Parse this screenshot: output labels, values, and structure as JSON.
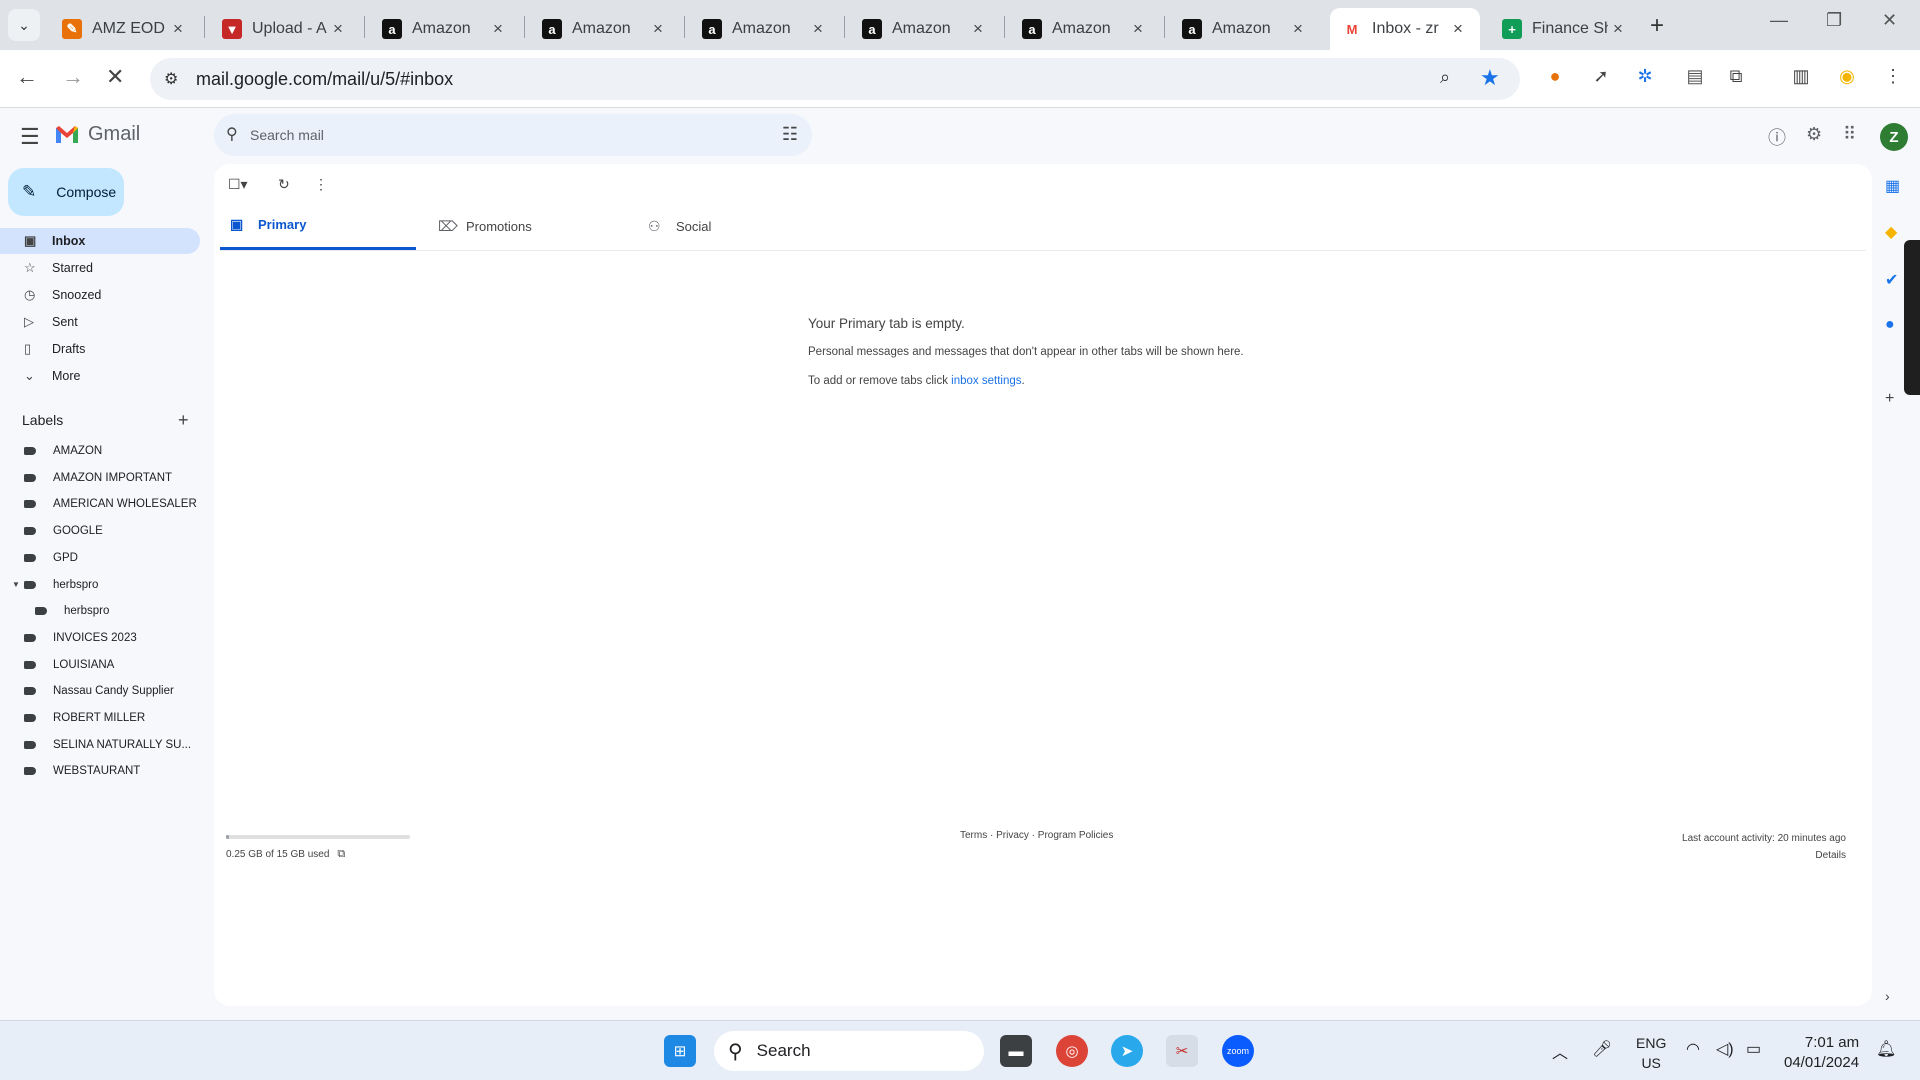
{
  "browser": {
    "tabs": [
      {
        "title": "AMZ EOD",
        "icon": "amz-eod-icon",
        "color": "#e8710a",
        "glyph": "✎"
      },
      {
        "title": "Upload - A",
        "icon": "upload-icon",
        "color": "#c62828",
        "glyph": "▼"
      },
      {
        "title": "Amazon",
        "icon": "amazon-icon",
        "color": "#111111",
        "glyph": "a"
      },
      {
        "title": "Amazon",
        "icon": "amazon-icon",
        "color": "#111111",
        "glyph": "a"
      },
      {
        "title": "Amazon",
        "icon": "amazon-icon",
        "color": "#111111",
        "glyph": "a"
      },
      {
        "title": "Amazon",
        "icon": "amazon-icon",
        "color": "#111111",
        "glyph": "a"
      },
      {
        "title": "Amazon",
        "icon": "amazon-icon",
        "color": "#111111",
        "glyph": "a"
      },
      {
        "title": "Amazon",
        "icon": "amazon-icon",
        "color": "#111111",
        "glyph": "a"
      },
      {
        "title": "Inbox - zr",
        "icon": "gmail-icon",
        "color": "#ffffff",
        "glyph": "M",
        "active": true
      },
      {
        "title": "Finance Sh",
        "icon": "sheets-icon",
        "color": "#0f9d58",
        "glyph": "+"
      }
    ],
    "url": "mail.google.com/mail/u/5/#inbox"
  },
  "gmail": {
    "app_name": "Gmail",
    "search_placeholder": "Search mail",
    "compose_label": "Compose",
    "avatar_initial": "Z",
    "nav": [
      {
        "label": "Inbox",
        "icon": "inbox-icon",
        "glyph": "▣",
        "active": true
      },
      {
        "label": "Starred",
        "icon": "star-icon",
        "glyph": "☆"
      },
      {
        "label": "Snoozed",
        "icon": "clock-icon",
        "glyph": "◷"
      },
      {
        "label": "Sent",
        "icon": "send-icon",
        "glyph": "▷"
      },
      {
        "label": "Drafts",
        "icon": "draft-icon",
        "glyph": "▯"
      },
      {
        "label": "More",
        "icon": "chevron-down-icon",
        "glyph": "⌄"
      }
    ],
    "labels_heading": "Labels",
    "labels": [
      {
        "name": "AMAZON"
      },
      {
        "name": "AMAZON IMPORTANT"
      },
      {
        "name": "AMERICAN WHOLESALER"
      },
      {
        "name": "GOOGLE"
      },
      {
        "name": "GPD"
      },
      {
        "name": "herbspro",
        "expanded": true
      },
      {
        "name": "herbspro",
        "child": true
      },
      {
        "name": "INVOICES 2023"
      },
      {
        "name": "LOUISIANA"
      },
      {
        "name": "Nassau Candy Supplier"
      },
      {
        "name": "ROBERT MILLER"
      },
      {
        "name": "SELINA NATURALLY SU..."
      },
      {
        "name": "WEBSTAURANT"
      }
    ],
    "category_tabs": [
      {
        "label": "Primary",
        "icon": "inbox-tab-icon",
        "glyph": "▣",
        "active": true
      },
      {
        "label": "Promotions",
        "icon": "tag-icon",
        "glyph": "⌦"
      },
      {
        "label": "Social",
        "icon": "people-icon",
        "glyph": "⚇"
      }
    ],
    "empty_state": {
      "heading": "Your Primary tab is empty.",
      "line1": "Personal messages and messages that don't appear in other tabs will be shown here.",
      "line2_prefix": "To add or remove tabs click ",
      "line2_link": "inbox settings",
      "line2_suffix": "."
    },
    "storage": {
      "text": "0.25 GB of 15 GB used",
      "fraction": 0.017
    },
    "footer": {
      "links": "Terms · Privacy · Program Policies"
    },
    "activity": {
      "line1": "Last account activity: 20 minutes ago",
      "line2": "Details"
    }
  },
  "taskbar": {
    "search_label": "Search",
    "lang_line1": "ENG",
    "lang_line2": "US",
    "time": "7:01 am",
    "date": "04/01/2024"
  }
}
